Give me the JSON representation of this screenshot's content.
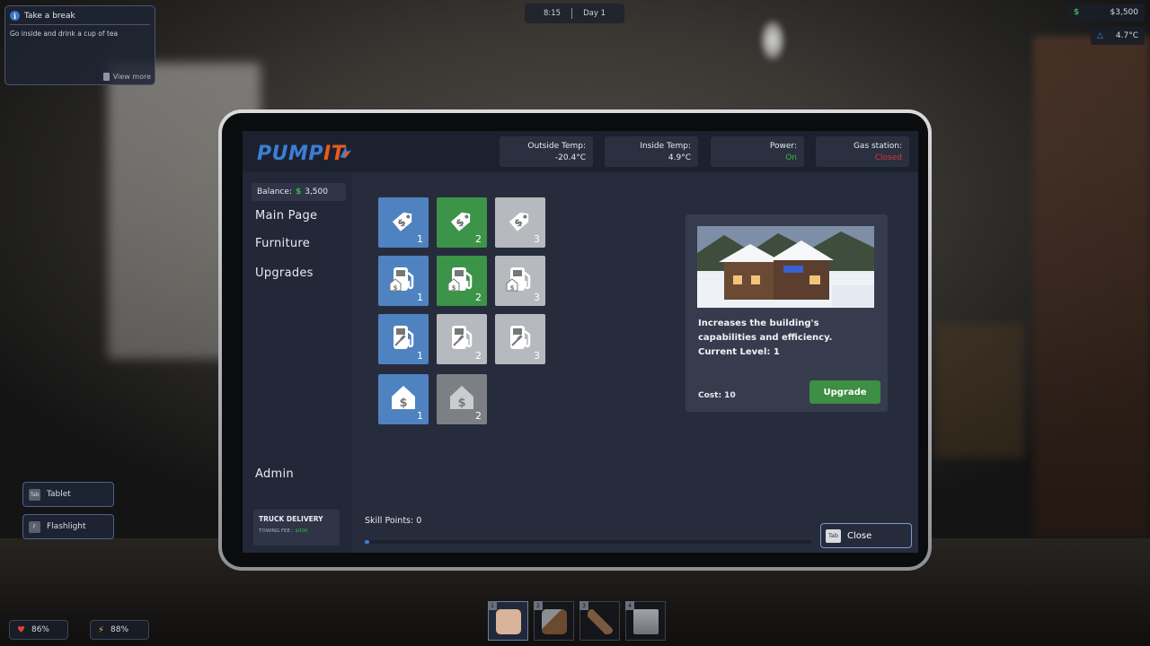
{
  "hud": {
    "task_title": "Take a break",
    "task_description": "Go inside and drink a cup of tea",
    "task_view_more": "View more",
    "time": "8:15",
    "day": "Day 1",
    "money": "$3,500",
    "money_icon": "$",
    "temperature": "4.7°C",
    "side_buttons": [
      {
        "key": "Tab",
        "label": "Tablet"
      },
      {
        "key": "F",
        "label": "Flashlight"
      }
    ],
    "health": "86%",
    "energy": "88%",
    "hotbar": [
      {
        "num": "1",
        "item": "fist"
      },
      {
        "num": "2",
        "item": "axe"
      },
      {
        "num": "3",
        "item": "shotgun"
      },
      {
        "num": "4",
        "item": "tool"
      }
    ]
  },
  "tablet": {
    "logo_part1": "PUMP",
    "logo_part2": "IT",
    "stats": [
      {
        "label": "Outside Temp:",
        "value": "-20.4°C",
        "status": "normal"
      },
      {
        "label": "Inside Temp:",
        "value": "4.9°C",
        "status": "normal"
      },
      {
        "label": "Power:",
        "value": "On",
        "status": "good"
      },
      {
        "label": "Gas station:",
        "value": "Closed",
        "status": "bad"
      }
    ],
    "balance_label": "Balance:",
    "balance_value": "3,500",
    "nav": {
      "main_page": "Main Page",
      "furniture": "Furniture",
      "upgrades": "Upgrades",
      "admin": "Admin"
    },
    "truck": {
      "title": "TRUCK DELIVERY",
      "fee_label": "TOWING FEE :",
      "fee_value": "$000"
    },
    "upgrade_tiles": [
      {
        "icon": "price-tag-icon",
        "level": "1",
        "state": "owned"
      },
      {
        "icon": "price-tag-icon",
        "level": "2",
        "state": "selected"
      },
      {
        "icon": "price-tag-icon",
        "level": "3",
        "state": "locked"
      },
      {
        "icon": "fuel-pump-dollar-icon",
        "level": "1",
        "state": "owned"
      },
      {
        "icon": "fuel-pump-dollar-icon",
        "level": "2",
        "state": "selected"
      },
      {
        "icon": "fuel-pump-dollar-icon",
        "level": "3",
        "state": "locked"
      },
      {
        "icon": "fuel-pump-hammer-icon",
        "level": "1",
        "state": "owned"
      },
      {
        "icon": "fuel-pump-hammer-icon",
        "level": "2",
        "state": "locked"
      },
      {
        "icon": "fuel-pump-hammer-icon",
        "level": "3",
        "state": "locked"
      },
      {
        "icon": "house-dollar-icon",
        "level": "1",
        "state": "owned"
      },
      {
        "icon": "house-dollar-icon",
        "level": "2",
        "state": "unavailable"
      }
    ],
    "detail": {
      "description": "Increases the building's capabilities and efficiency.",
      "current_level": "Current Level: 1",
      "cost": "Cost: 10",
      "upgrade_button": "Upgrade"
    },
    "skill_points": "Skill Points: 0",
    "skill_progress": 0.01,
    "close_key": "Tab",
    "close_label": "Close"
  },
  "colors": {
    "owned": "#4f82c0",
    "selected": "#3b9448",
    "locked": "#b6b9bd",
    "unavailable": "#7c7f84",
    "accent": "#3b7ed6",
    "brand_orange": "#e85a1c"
  }
}
